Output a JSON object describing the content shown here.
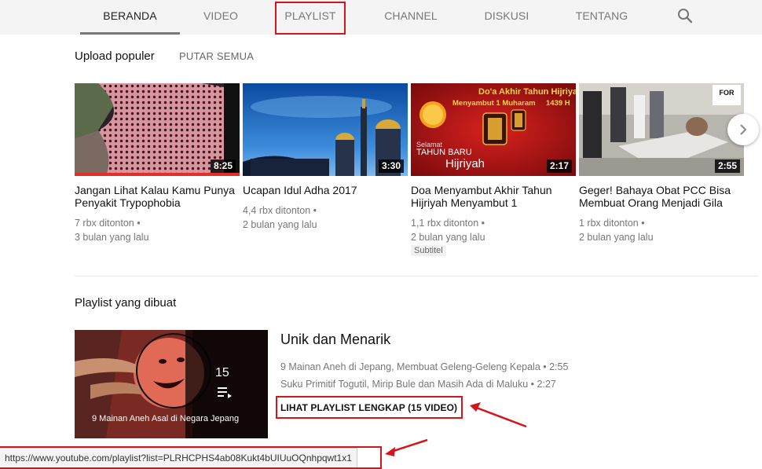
{
  "tabs": [
    {
      "label": "BERANDA"
    },
    {
      "label": "VIDEO"
    },
    {
      "label": "PLAYLIST"
    },
    {
      "label": "CHANNEL"
    },
    {
      "label": "DISKUSI"
    },
    {
      "label": "TENTANG"
    }
  ],
  "search_icon": "search-icon",
  "uploads": {
    "title": "Upload populer",
    "play_all": "PUTAR SEMUA",
    "videos": [
      {
        "title": "Jangan Lihat Kalau Kamu Punya Penyakit Trypophobia",
        "duration": "8:25",
        "views": "7 rbx ditonton",
        "age": "3 bulan yang lalu",
        "watched_fraction": 1.0
      },
      {
        "title": "Ucapan Idul Adha 2017",
        "duration": "3:30",
        "views": "4,4 rbx ditonton",
        "age": "2 bulan yang lalu"
      },
      {
        "title": "Doa Menyambut Akhir Tahun Hijriyah Menyambut 1",
        "duration": "2:17",
        "views": "1,1 rbx ditonton",
        "age": "2 bulan yang lalu",
        "badge": "Subtitel",
        "thumb_text": {
          "line1": "Do'a Akhir Tahun Hijriyah",
          "line2": "Menyambut 1 Muharam",
          "year": "1439 H",
          "selamat": "Selamat",
          "tahun_baru": "TAHUN BARU",
          "hijriyah": "Hijriyah"
        }
      },
      {
        "title": "Geger! Bahaya Obat PCC Bisa Membuat Orang Menjadi Gila",
        "duration": "2:55",
        "views": "1 rbx ditonton",
        "age": "2 bulan yang lalu"
      }
    ]
  },
  "playlists": {
    "title": "Playlist yang dibuat",
    "item": {
      "title": "Unik dan Menarik",
      "count": "15",
      "caption": "9 Mainan Aneh Asal di Negara Jepang",
      "videos": [
        {
          "name": "9 Mainan Aneh di Jepang, Membuat Geleng-Geleng Kepala",
          "duration": "2:55"
        },
        {
          "name": "Suku Primitif Togutil, Mirip Bule dan Masih Ada di Maluku",
          "duration": "2:27"
        }
      ],
      "view_full": "LIHAT PLAYLIST LENGKAP (15 VIDEO)"
    }
  },
  "status_url": "https://www.youtube.com/playlist?list=PLRHCPHS4ab08Kukt4bUIUuOQnhpqwt1x1",
  "colors": {
    "annotation_red": "#d6151b",
    "progress_red": "#e52d27",
    "tabbar_bg": "#f4f4f4"
  }
}
